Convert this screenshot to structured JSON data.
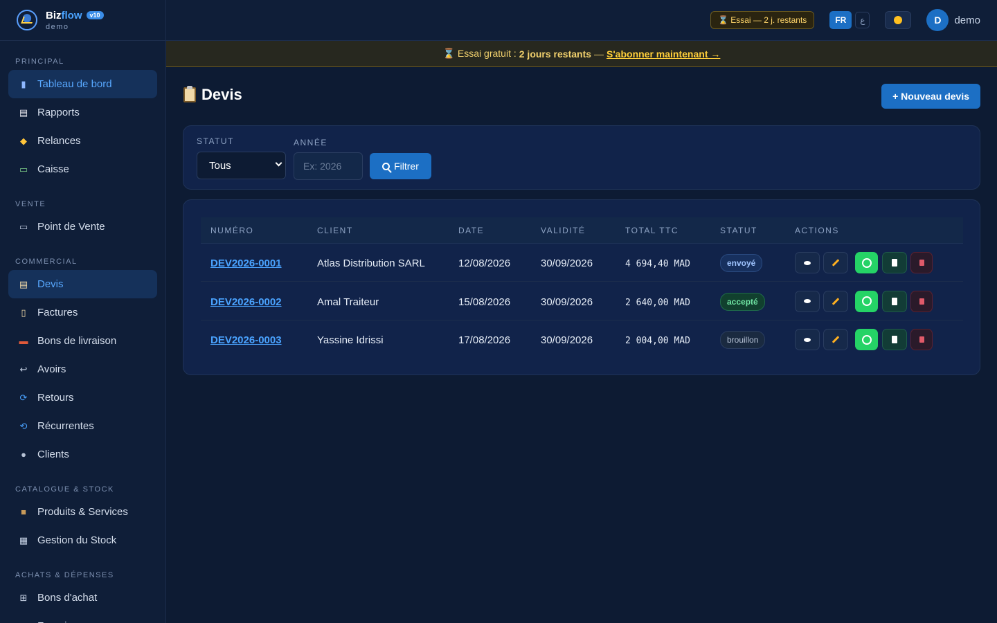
{
  "brand": {
    "name_part1": "Biz",
    "name_part2": "flow",
    "version": "v10",
    "subtitle": "demo"
  },
  "sidebar": {
    "sections": [
      {
        "title": "PRINCIPAL",
        "items": [
          {
            "label": "Tableau de bord",
            "icon": "chart-icon",
            "active": true
          },
          {
            "label": "Rapports",
            "icon": "report-icon"
          },
          {
            "label": "Relances",
            "icon": "bell-icon"
          },
          {
            "label": "Caisse",
            "icon": "cash-icon"
          }
        ]
      },
      {
        "title": "VENTE",
        "items": [
          {
            "label": "Point de Vente",
            "icon": "monitor-icon"
          }
        ]
      },
      {
        "title": "COMMERCIAL",
        "items": [
          {
            "label": "Devis",
            "icon": "clipboard-icon",
            "active": true
          },
          {
            "label": "Factures",
            "icon": "invoice-icon"
          },
          {
            "label": "Bons de livraison",
            "icon": "truck-icon"
          },
          {
            "label": "Avoirs",
            "icon": "return-arrow-icon"
          },
          {
            "label": "Retours",
            "icon": "refresh-icon"
          },
          {
            "label": "Récurrentes",
            "icon": "repeat-icon"
          },
          {
            "label": "Clients",
            "icon": "users-icon"
          }
        ]
      },
      {
        "title": "CATALOGUE & STOCK",
        "items": [
          {
            "label": "Produits & Services",
            "icon": "box-icon"
          },
          {
            "label": "Gestion du Stock",
            "icon": "warehouse-icon"
          }
        ]
      },
      {
        "title": "ACHATS & DÉPENSES",
        "items": [
          {
            "label": "Bons d'achat",
            "icon": "cart-icon"
          },
          {
            "label": "Fournisseurs",
            "icon": "factory-icon"
          }
        ]
      }
    ]
  },
  "topbar": {
    "trial_pill": "⌛ Essai — 2 j. restants",
    "lang_fr": "FR",
    "lang_ar": "ع",
    "avatar_initial": "D",
    "user_name": "demo"
  },
  "banner": {
    "prefix": "⌛ Essai gratuit :",
    "days": "2 jours restants",
    "dash": "—",
    "cta": "S'abonner maintenant →"
  },
  "page": {
    "title": "Devis",
    "new_button": "+ Nouveau devis"
  },
  "filters": {
    "status_label": "STATUT",
    "status_value": "Tous",
    "year_label": "ANNÉE",
    "year_placeholder": "Ex: 2026",
    "filter_button": "Filtrer"
  },
  "table": {
    "columns": [
      "NUMÉRO",
      "CLIENT",
      "DATE",
      "VALIDITÉ",
      "TOTAL TTC",
      "STATUT",
      "ACTIONS"
    ],
    "rows": [
      {
        "numero": "DEV2026-0001",
        "client": "Atlas Distribution SARL",
        "date": "12/08/2026",
        "validite": "30/09/2026",
        "total": "4 694,40 MAD",
        "statut": "envoyé",
        "statut_kind": "sent"
      },
      {
        "numero": "DEV2026-0002",
        "client": "Amal Traiteur",
        "date": "15/08/2026",
        "validite": "30/09/2026",
        "total": "2 640,00 MAD",
        "statut": "accepté",
        "statut_kind": "accepted"
      },
      {
        "numero": "DEV2026-0003",
        "client": "Yassine Idrissi",
        "date": "17/08/2026",
        "validite": "30/09/2026",
        "total": "2 004,00 MAD",
        "statut": "brouillon",
        "statut_kind": "draft"
      }
    ]
  },
  "colors": {
    "accent": "#1c6fc4",
    "background": "#0d1b33",
    "sidebar": "#0f1e38",
    "link": "#4aa3ff",
    "warning": "#ffcf3a"
  }
}
